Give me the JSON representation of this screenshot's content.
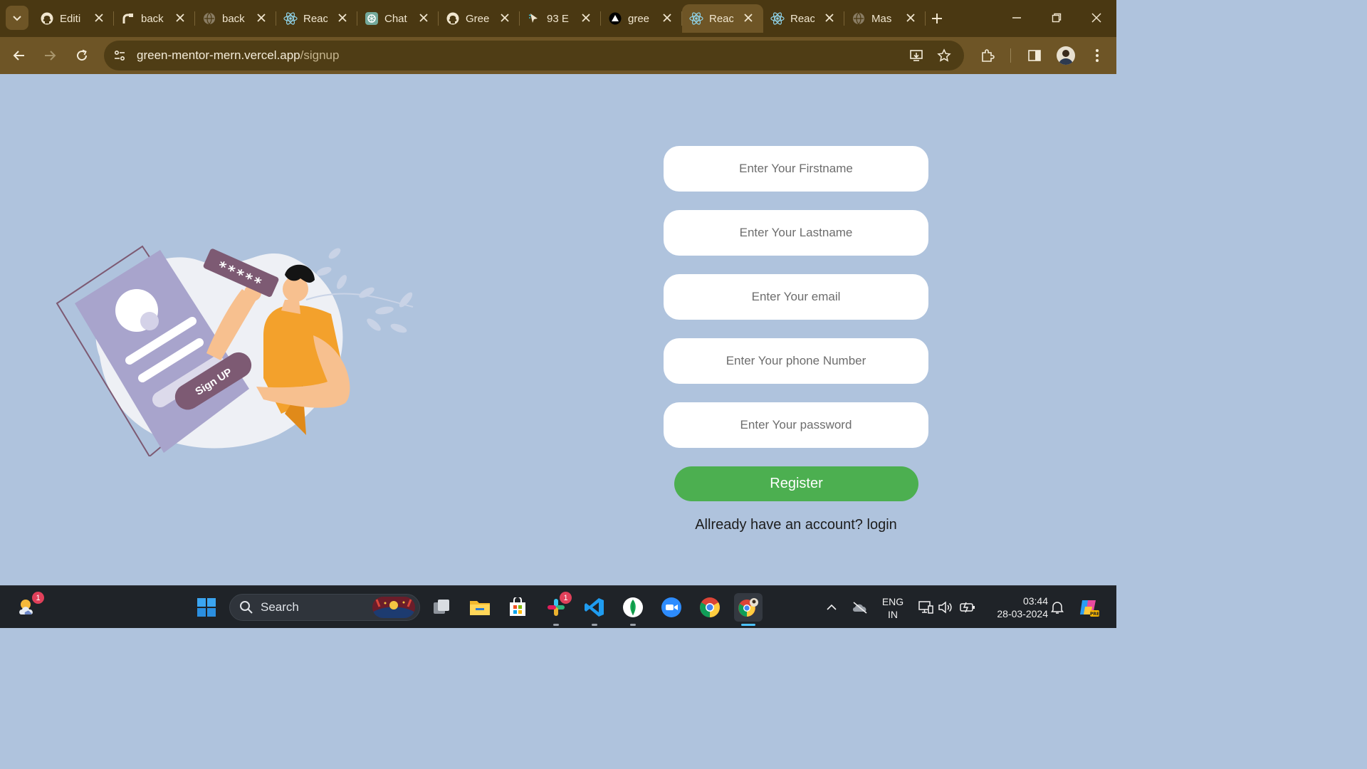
{
  "browser": {
    "tabs": [
      {
        "title": "Editi",
        "icon": "github-icon"
      },
      {
        "title": "back",
        "icon": "render-icon"
      },
      {
        "title": "back",
        "icon": "globe-icon"
      },
      {
        "title": "Reac",
        "icon": "react-icon"
      },
      {
        "title": "Chat",
        "icon": "chatgpt-icon"
      },
      {
        "title": "Gree",
        "icon": "github-icon"
      },
      {
        "title": "93 E",
        "icon": "cursor-icon"
      },
      {
        "title": "gree",
        "icon": "vercel-icon"
      },
      {
        "title": "Reac",
        "icon": "react-icon",
        "active": true
      },
      {
        "title": "Reac",
        "icon": "react-icon"
      },
      {
        "title": "Mas",
        "icon": "globe-icon"
      }
    ],
    "url_host": "green-mentor-mern.vercel.app",
    "url_path": "/signup"
  },
  "page": {
    "illustration_label": "Sign UP",
    "password_mask": "*****",
    "form": {
      "firstname_placeholder": "Enter Your Firstname",
      "lastname_placeholder": "Enter Your Lastname",
      "email_placeholder": "Enter Your email",
      "phone_placeholder": "Enter Your phone Number",
      "password_placeholder": "Enter Your password",
      "register_label": "Register",
      "login_prompt": "Allready have an account?",
      "login_link": "login"
    }
  },
  "taskbar": {
    "search_label": "Search",
    "weather_badge": "1",
    "slack_badge": "1",
    "language_line1": "ENG",
    "language_line2": "IN",
    "time": "03:44",
    "date": "28-03-2024"
  },
  "colors": {
    "page_background": "#afc3dd",
    "register_button": "#4caf50",
    "browser_frame": "#6e5526"
  }
}
